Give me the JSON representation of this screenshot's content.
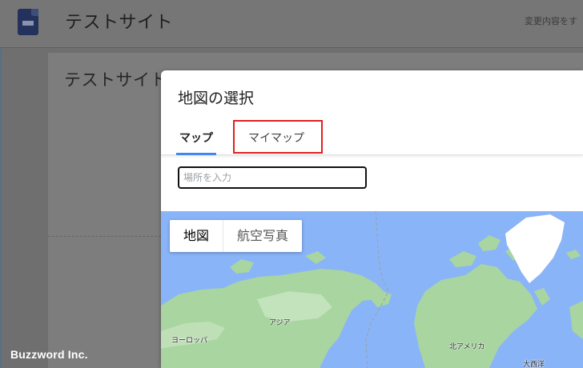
{
  "header": {
    "site_title": "テストサイト",
    "save_status": "変更内容をす"
  },
  "canvas": {
    "header_text": "テストサイト"
  },
  "dialog": {
    "title": "地図の選択",
    "tabs": [
      {
        "label": "マップ",
        "active": true
      },
      {
        "label": "マイマップ",
        "active": false
      }
    ],
    "search": {
      "placeholder": "場所を入力",
      "value": ""
    },
    "map": {
      "type_buttons": [
        {
          "label": "地図",
          "selected": true
        },
        {
          "label": "航空写真",
          "selected": false
        }
      ],
      "labels": {
        "asia": "アジア",
        "europe": "ヨーロッパ",
        "north_america": "北アメリカ",
        "atlantic": "大西洋"
      }
    }
  },
  "watermark": "Buzzword Inc.",
  "colors": {
    "tab_indicator": "#4285f4",
    "highlight_box": "#e02020",
    "ocean": "#8ab4f8",
    "land": "#a8d5a0"
  }
}
